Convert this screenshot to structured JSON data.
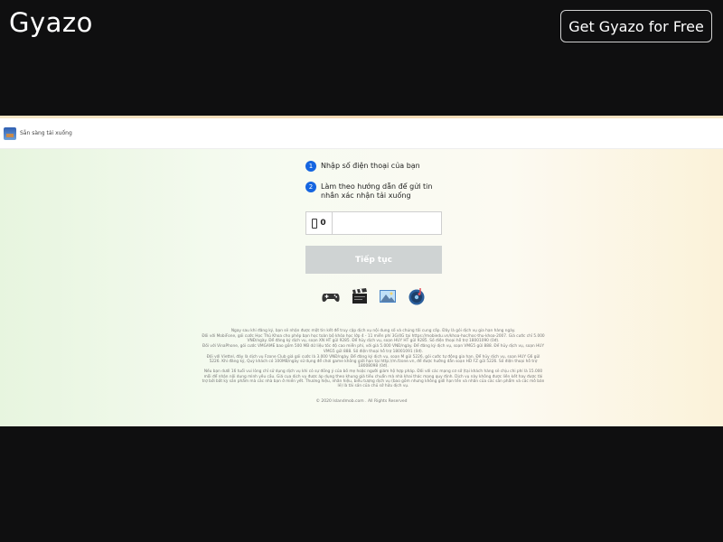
{
  "header": {
    "logo_text": "Gyazo",
    "cta_label": "Get Gyazo for Free"
  },
  "screenshot": {
    "app_title": "Sẵn sàng tải xuống",
    "steps": [
      {
        "number": "1",
        "text": "Nhập số điện thoại của bạn"
      },
      {
        "number": "2",
        "text": "Làm theo hướng dẫn để gửi tin nhắn xác nhận tải xuống"
      }
    ],
    "phone_prefix": "0",
    "phone_value": "",
    "continue_label": "Tiếp tục",
    "category_icons": [
      "gamepad-icon",
      "clapperboard-icon",
      "picture-icon",
      "music-disc-icon"
    ],
    "terms": [
      "Ngay sau khi đăng ký, bạn sẽ nhận được một tin kết để truy cập dịch vụ nội dung số và chúng tôi cung cấp. Đây là gói dịch vụ gia hạn hàng ngày.",
      "Đối với MobiFone, gói cước Học Thủ Khoa cho phép bạn học toàn bộ khóa học lớp 4 - 11 miễn phí 3G/4G tại https://mobiedu.vn/khoa-hoc/hoc-thu-khoa-2007. Giá cước chỉ 5.000 VNĐ/ngày. Để đăng ký dịch vụ, soạn XN HT gửi 9285. Để hủy dịch vụ, soạn HUY HT gửi 9285. Số điện thoại hỗ trợ 18001090 (0đ).",
      "Đối với VinaPhone, gói cước VMGAME bao gồm 500 MB dữ liệu tốc độ cao miễn phí, với giá 5.000 VNĐ/ngày. Để đăng ký dịch vụ, soạn VMG5 gửi 888. Để hủy dịch vụ, soạn HUY VMG5 gửi 888. Số điện thoại hỗ trợ 18001091 (0đ).",
      "Đối với Viettel, đây là dịch vụ Fzone Club giá gói cước là 3.000 VNĐ/ngày. Để đăng ký dịch vụ, soạn M gửi 5226, gói cước tự động gia hạn. Để hủy dịch vụ, soạn HUY G6 gửi 5226. Khi đăng ký, Quý khách có 100MB/ngày sử dụng để chơi game không giới hạn tại http://m.fzone.vn, để được hướng dẫn soạn HD FZ gửi 5226. Số điện thoại hỗ trợ 18008098 (0đ).",
      "Nếu bạn dưới 16 tuổi vui lòng chỉ sử dụng dịch vụ khi có sự đồng ý của bố mẹ hoặc người giám hộ hợp pháp. Đối với các mạng cơ sở (tại khách hàng sẽ chịu chi phí là 15.000 mỗi để nhận nội dung mình yêu cầu. Giá cụa dịch vụ được áp dụng theo khung giá tiêu chuẩn mà nhà khai thác mạng quy định. Dịch vụ này không được liên kết hay được tài trợ bởi bất kỳ sản phẩm mà các nhà bạn ở miền yết. Thương hiệu, nhãn hiệu, biểu tượng dịch vụ (bao gồm nhưng không giới hạn tên và nhãn của các sản phẩm và các mô bán lẻ) là tài sản của chủ sở hữu dịch vụ."
    ],
    "copyright": "© 2020 Islandmob.com . All Rights Reserved"
  }
}
